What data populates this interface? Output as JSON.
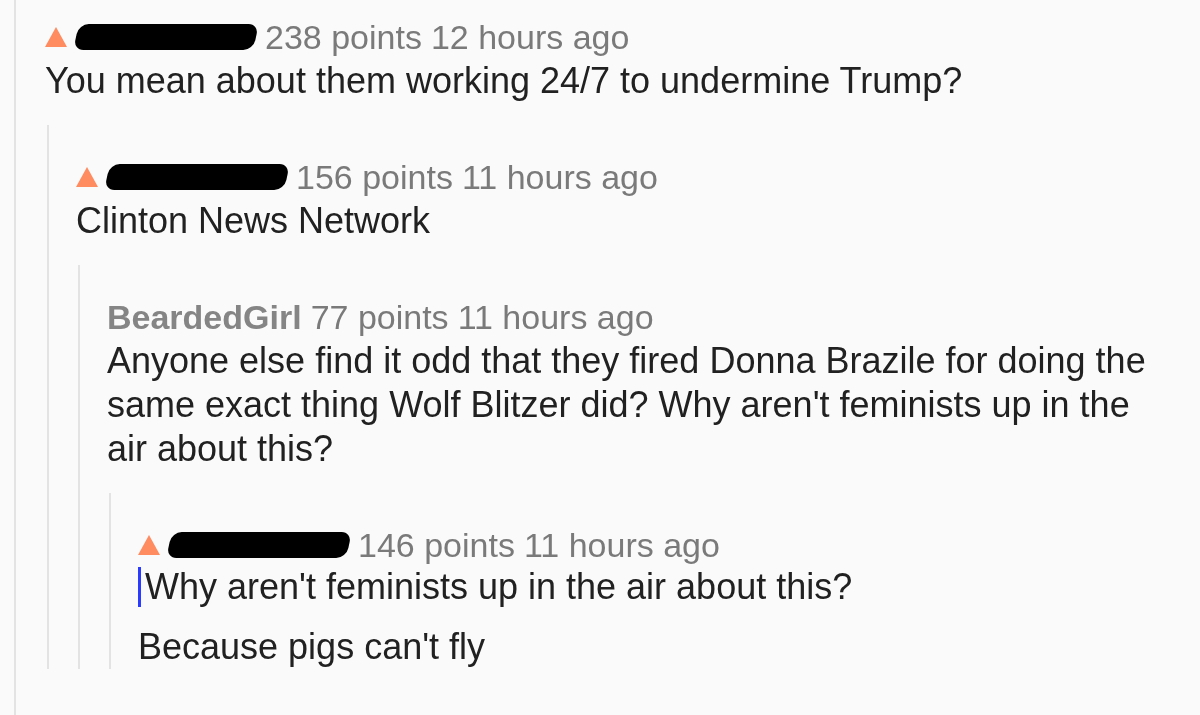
{
  "comments": [
    {
      "upvoted": true,
      "redacted": true,
      "points": "238 points",
      "time": "12 hours ago",
      "body": [
        {
          "kind": "text",
          "text": "You mean about them working 24/7 to undermine Trump?"
        }
      ],
      "children": [
        {
          "upvoted": true,
          "redacted": true,
          "points": "156 points",
          "time": "11 hours ago",
          "body": [
            {
              "kind": "text",
              "text": "Clinton News Network"
            }
          ],
          "children": [
            {
              "upvoted": false,
              "redacted": false,
              "username": "BeardedGirl",
              "points": "77 points",
              "time": "11 hours ago",
              "body": [
                {
                  "kind": "text",
                  "text": "Anyone else find it odd that they fired Donna Brazile for doing the same exact thing Wolf Blitzer did? Why aren't feminists up in the air about this?"
                }
              ],
              "children": [
                {
                  "upvoted": true,
                  "redacted": true,
                  "points": "146 points",
                  "time": "11 hours ago",
                  "body": [
                    {
                      "kind": "quote",
                      "text": "Why aren't feminists up in the air about this?"
                    },
                    {
                      "kind": "text",
                      "text": "Because pigs can't fly"
                    }
                  ]
                }
              ]
            }
          ]
        }
      ]
    }
  ]
}
